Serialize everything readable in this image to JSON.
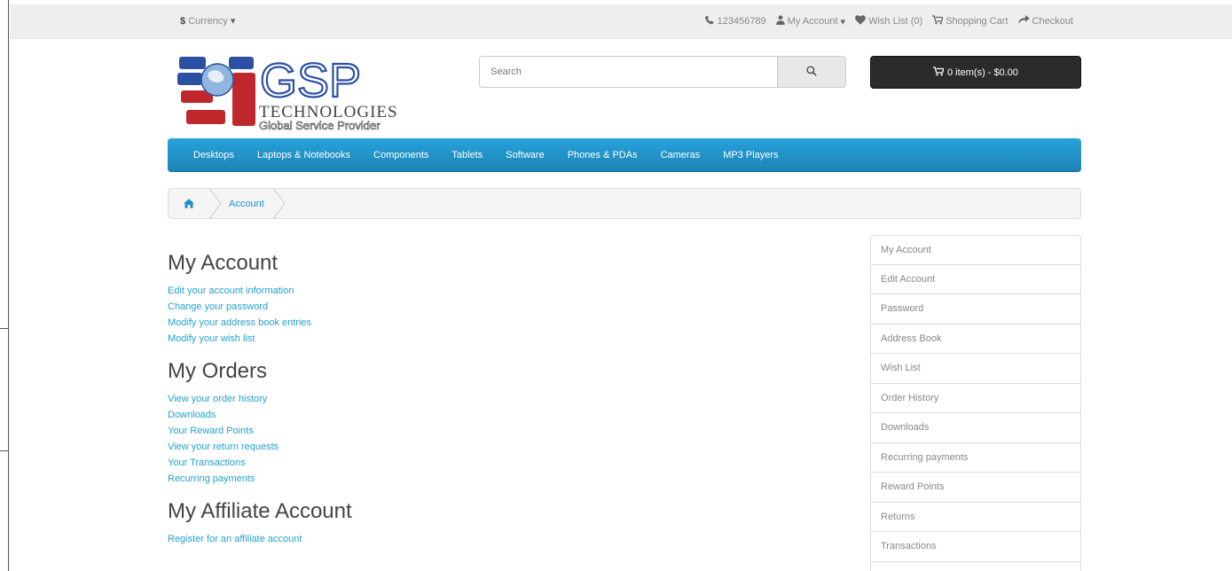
{
  "topbar": {
    "currency_symbol": "$",
    "currency_label": "Currency",
    "phone": "123456789",
    "my_account": "My Account",
    "wish_list": "Wish List (0)",
    "shopping_cart": "Shopping Cart",
    "checkout": "Checkout"
  },
  "logo": {
    "brand": "GSP",
    "line1": "TECHNOLOGIES",
    "line2": "Global Service Provider"
  },
  "search": {
    "placeholder": "Search"
  },
  "cart": {
    "label": "0 item(s) - $0.00"
  },
  "menu": {
    "items": [
      "Desktops",
      "Laptops & Notebooks",
      "Components",
      "Tablets",
      "Software",
      "Phones & PDAs",
      "Cameras",
      "MP3 Players"
    ]
  },
  "breadcrumb": {
    "current": "Account"
  },
  "sections": {
    "account": {
      "title": "My Account",
      "links": [
        "Edit your account information",
        "Change your password",
        "Modify your address book entries",
        "Modify your wish list"
      ]
    },
    "orders": {
      "title": "My Orders",
      "links": [
        "View your order history",
        "Downloads",
        "Your Reward Points",
        "View your return requests",
        "Your Transactions",
        "Recurring payments"
      ]
    },
    "affiliate": {
      "title": "My Affiliate Account",
      "links": [
        "Register for an affiliate account"
      ]
    }
  },
  "sidebar": {
    "items": [
      "My Account",
      "Edit Account",
      "Password",
      "Address Book",
      "Wish List",
      "Order History",
      "Downloads",
      "Recurring payments",
      "Reward Points",
      "Returns",
      "Transactions",
      ""
    ]
  },
  "colors": {
    "menu": "#229ac8",
    "link": "#23a1d1",
    "cart": "#2b2b2b",
    "logo_red": "#c0272d",
    "logo_blue": "#2b4fa3"
  }
}
